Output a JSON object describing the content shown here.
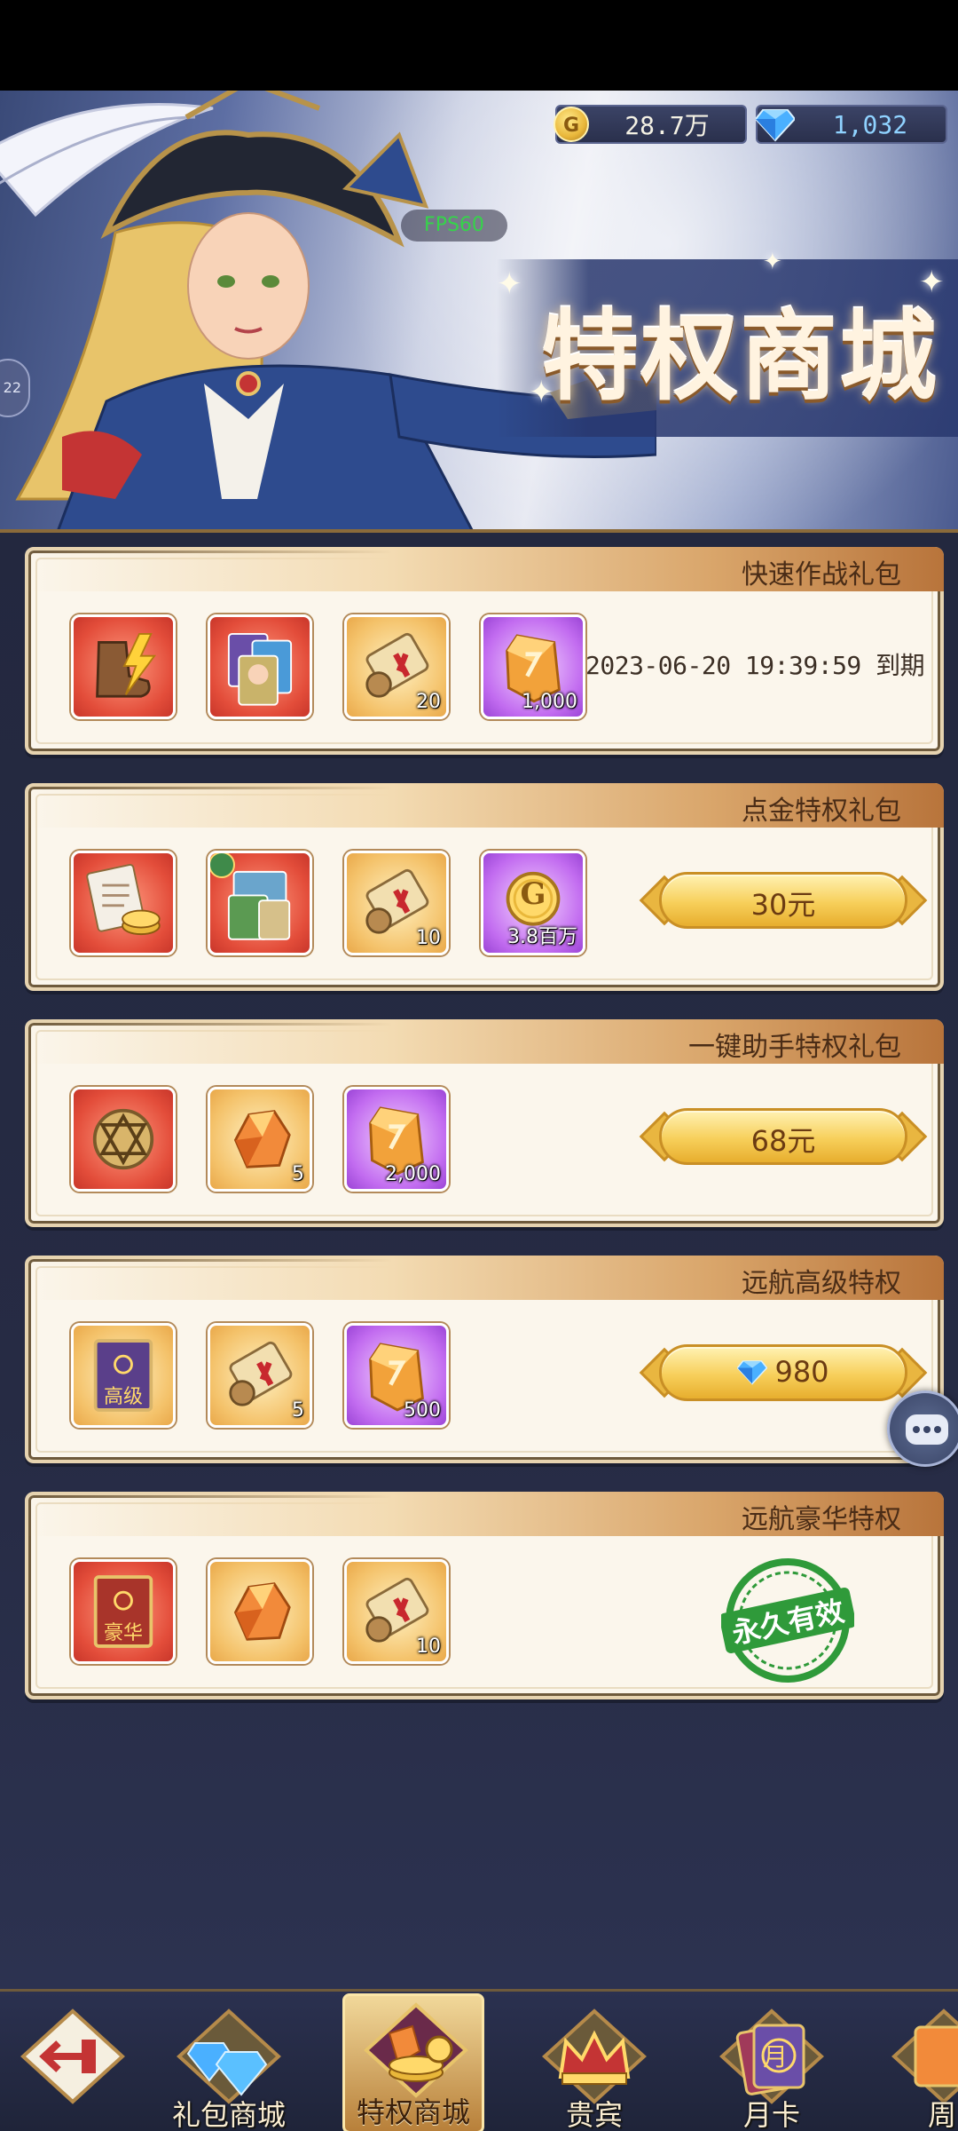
{
  "header": {
    "gold_value": "28.7万",
    "gem_value": "1,032",
    "gold_icon_letter": "G",
    "fps": "FPS60",
    "side_pill_text": "22",
    "title": "特权商城"
  },
  "packages": [
    {
      "name": "快速作战礼包",
      "items": [
        {
          "icon": "boot-lightning-icon",
          "bg": "red",
          "qty": ""
        },
        {
          "icon": "heroes-cards-icon",
          "bg": "red",
          "qty": ""
        },
        {
          "icon": "scroll-icon",
          "bg": "gold",
          "qty": "20"
        },
        {
          "icon": "amber-crystal-icon",
          "bg": "purple",
          "qty": "1,000"
        }
      ],
      "expire_text": "2023-06-20 19:39:59 到期"
    },
    {
      "name": "点金特权礼包",
      "items": [
        {
          "icon": "letter-gold-icon",
          "bg": "red",
          "qty": ""
        },
        {
          "icon": "map-cards-icon",
          "bg": "red",
          "qty": ""
        },
        {
          "icon": "scroll-icon",
          "bg": "gold",
          "qty": "10"
        },
        {
          "icon": "gold-coin-icon",
          "bg": "purple",
          "qty": "3.8百万"
        }
      ],
      "price": "30元"
    },
    {
      "name": "一键助手特权礼包",
      "items": [
        {
          "icon": "compass-medal-icon",
          "bg": "red",
          "qty": ""
        },
        {
          "icon": "orange-ore-icon",
          "bg": "gold",
          "qty": "5"
        },
        {
          "icon": "amber-crystal-icon",
          "bg": "purple",
          "qty": "2,000"
        }
      ],
      "price": "68元"
    },
    {
      "name": "远航高级特权",
      "items": [
        {
          "icon": "advanced-book-icon",
          "bg": "gold",
          "qty": "",
          "book_label": "高级"
        },
        {
          "icon": "scroll-icon",
          "bg": "gold",
          "qty": "5"
        },
        {
          "icon": "amber-crystal-icon",
          "bg": "purple",
          "qty": "500"
        }
      ],
      "price": "980"
    },
    {
      "name": "远航豪华特权",
      "items": [
        {
          "icon": "luxury-book-icon",
          "bg": "red",
          "qty": "",
          "book_label": "豪华"
        },
        {
          "icon": "orange-ore-icon",
          "bg": "gold",
          "qty": ""
        },
        {
          "icon": "scroll-icon",
          "bg": "gold",
          "qty": "10"
        }
      ],
      "stamp": "永久有效"
    }
  ],
  "nav": {
    "back": "",
    "gift_shop": "礼包商城",
    "privilege_shop": "特权商城",
    "vip": "贵宾",
    "month_card": "月卡",
    "month_card_icon_text": "月",
    "weekly": "周"
  },
  "colors": {
    "accent_gold": "#f7cf5a",
    "card_bg": "#fbf6ec",
    "page_bg": "#23283f",
    "fps_green": "#35d44a",
    "stamp_green": "#2f9a3a"
  }
}
